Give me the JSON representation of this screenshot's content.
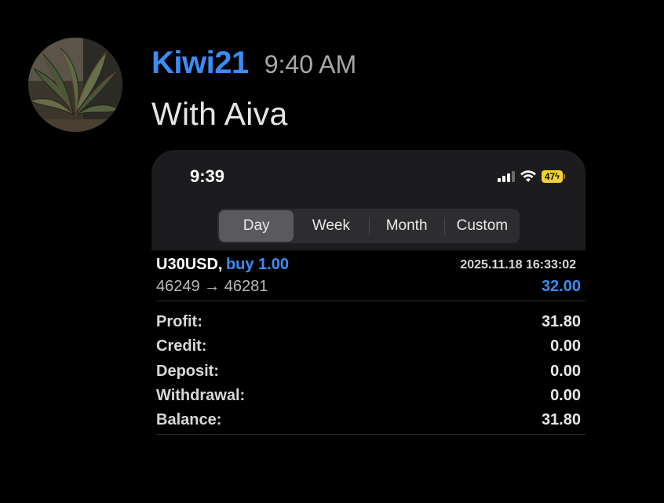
{
  "message": {
    "username": "Kiwi21",
    "timestamp": "9:40 AM",
    "text": "With Aiva"
  },
  "phone": {
    "status_time": "9:39",
    "battery": "47",
    "tabs": [
      {
        "label": "Day",
        "active": true
      },
      {
        "label": "Week",
        "active": false
      },
      {
        "label": "Month",
        "active": false
      },
      {
        "label": "Custom",
        "active": false
      }
    ],
    "deal": {
      "symbol": "U30USD,",
      "side": "buy 1.00",
      "time": "2025.11.18 16:33:02",
      "prices": "46249 → 46281",
      "profit": "32.00"
    },
    "summary": [
      {
        "label": "Profit:",
        "value": "31.80"
      },
      {
        "label": "Credit:",
        "value": "0.00"
      },
      {
        "label": "Deposit:",
        "value": "0.00"
      },
      {
        "label": "Withdrawal:",
        "value": "0.00"
      },
      {
        "label": "Balance:",
        "value": "31.80"
      }
    ]
  },
  "colors": {
    "accent_blue": "#3b8cf6",
    "battery_yellow": "#f5cf3a",
    "background": "#000000"
  }
}
